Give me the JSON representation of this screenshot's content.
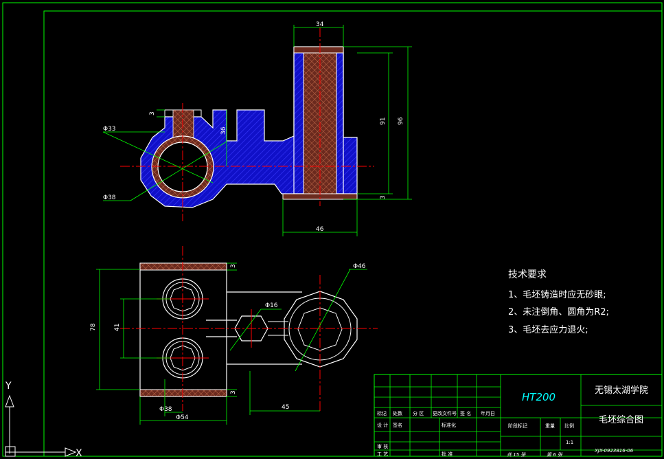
{
  "drawing": {
    "colors": {
      "background": "#000000",
      "border": "#00ff00",
      "outline": "#ffffff",
      "centerline": "#ff0000",
      "hatch_blue": "#1010c8",
      "hatch_brown": "#8b3a2a",
      "dimension": "#00ff00",
      "titleblock_cyan": "#00ffff"
    },
    "top_view_dims": {
      "d34": "34",
      "d96": "96",
      "d91": "91",
      "d3_right": "3",
      "d46": "46",
      "d3_left": "3",
      "d36": "36",
      "phi33": "Φ33",
      "phi38": "Φ38"
    },
    "front_view_dims": {
      "d78": "78",
      "d41": "41",
      "d3_top": "3",
      "d3_bottom": "3",
      "phi16": "Φ16",
      "phi46": "Φ46",
      "d45": "45",
      "phi38": "Φ38",
      "phi54": "Φ54"
    },
    "tech_requirements": {
      "title": "技术要求",
      "items": [
        "1、毛坯铸造时应无砂眼;",
        "2、未注倒角、圆角为R2;",
        "3、毛坯去应力退火;"
      ]
    },
    "title_block": {
      "material": "HT200",
      "school": "无锡太湖学院",
      "drawing_name": "毛坯综合图",
      "drawing_no": "XJX-0923816-06",
      "header_labels": [
        "标记",
        "处数",
        "分 区",
        "更改文件号",
        "签 名",
        "年月日"
      ],
      "row_labels": [
        "设 计",
        "签名",
        "标准化"
      ],
      "stage_label": "阶段标记",
      "weight_label": "重量",
      "scale_label": "比例",
      "scale_value": "1:1",
      "sheets_total": "共 15 张",
      "sheet_no": "第 6 张",
      "audit_label": "审 核",
      "process_label": "工 艺",
      "approve_label": "批 准"
    },
    "axes": {
      "y_label": "Y",
      "x_label": "X"
    }
  }
}
